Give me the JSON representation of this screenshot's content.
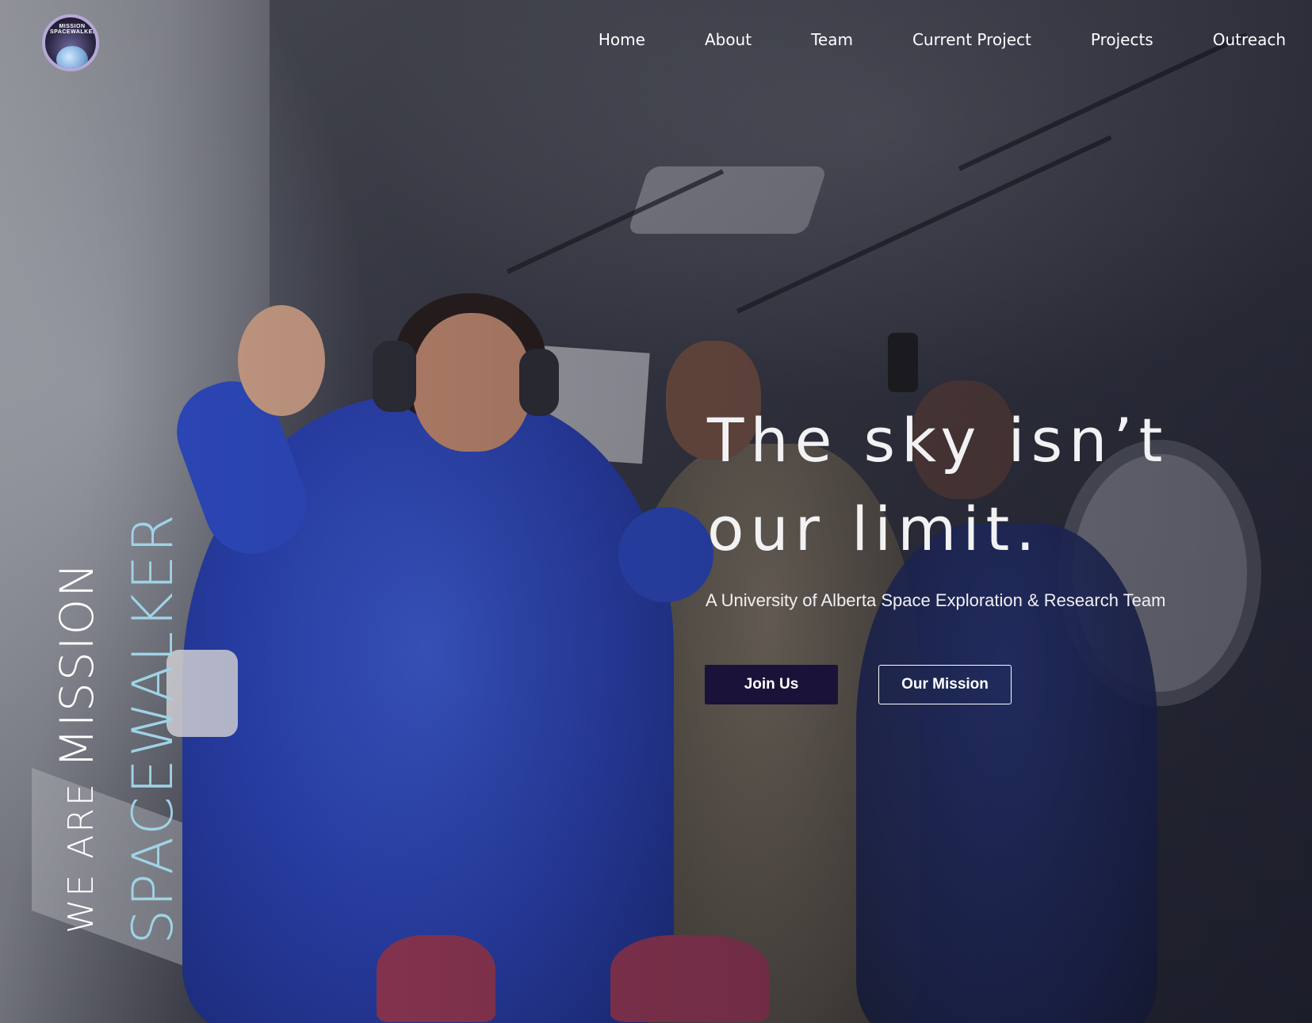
{
  "logo": {
    "text": "MISSION SPACEWALKER"
  },
  "nav": {
    "items": [
      {
        "label": "Home"
      },
      {
        "label": "About"
      },
      {
        "label": "Team"
      },
      {
        "label": "Current Project"
      },
      {
        "label": "Projects"
      },
      {
        "label": "Outreach"
      }
    ]
  },
  "vertical_title": {
    "line1_prefix": "WE ARE ",
    "line1_main": "MISSION",
    "line2": "SPACEWALKER",
    "line2_color": "#9fd3e6"
  },
  "hero": {
    "headline_line1": "The sky isn’t",
    "headline_line2": "our limit.",
    "subtitle": "A University of Alberta Space Exploration & Research Team",
    "primary_button": "Join Us",
    "secondary_button": "Our Mission",
    "primary_button_color": "#1a1238"
  }
}
